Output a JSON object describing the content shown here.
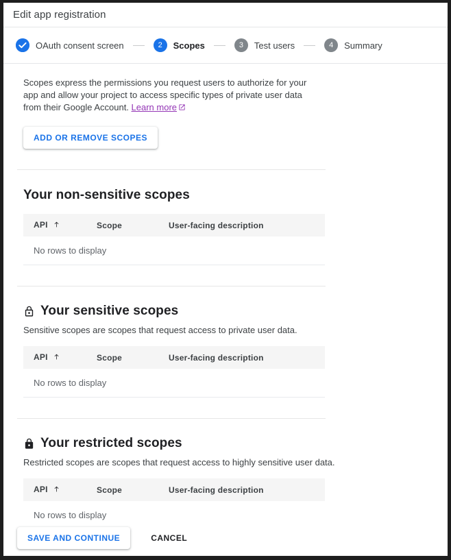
{
  "window": {
    "title": "Edit app registration"
  },
  "stepper": {
    "steps": [
      {
        "marker": "check",
        "label": "OAuth consent screen",
        "state": "done"
      },
      {
        "marker": "2",
        "label": "Scopes",
        "state": "active"
      },
      {
        "marker": "3",
        "label": "Test users",
        "state": "todo"
      },
      {
        "marker": "4",
        "label": "Summary",
        "state": "todo"
      }
    ]
  },
  "intro": {
    "text": "Scopes express the permissions you request users to authorize for your app and allow your project to access specific types of private user data from their Google Account. ",
    "link_label": "Learn more",
    "link_icon": "open-in-new-icon"
  },
  "actions": {
    "add_remove_scopes": "ADD OR REMOVE SCOPES"
  },
  "table_headers": {
    "api": "API",
    "scope": "Scope",
    "description": "User-facing description",
    "sort_icon": "sort-ascending-arrow-icon"
  },
  "empty_row": "No rows to display",
  "sections": [
    {
      "id": "non-sensitive",
      "icon": null,
      "title": "Your non-sensitive scopes",
      "description": null
    },
    {
      "id": "sensitive",
      "icon": "lock-outline-icon",
      "title": "Your sensitive scopes",
      "description": "Sensitive scopes are scopes that request access to private user data."
    },
    {
      "id": "restricted",
      "icon": "lock-filled-icon",
      "title": "Your restricted scopes",
      "description": "Restricted scopes are scopes that request access to highly sensitive user data."
    }
  ],
  "footer": {
    "save_label": "SAVE AND CONTINUE",
    "cancel_label": "CANCEL"
  },
  "colors": {
    "accent_blue": "#1a73e8",
    "step_inactive_gray": "#80868b",
    "link_purple": "#9334b5",
    "text_primary": "#202124",
    "text_secondary": "#3c4043",
    "text_muted": "#5f6368",
    "table_header_bg": "#f5f5f5"
  }
}
